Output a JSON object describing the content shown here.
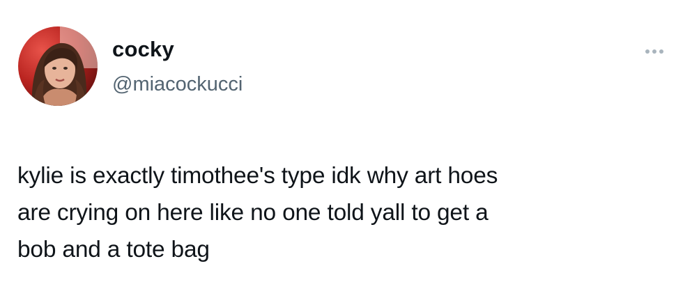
{
  "tweet": {
    "author": {
      "display_name": "cocky",
      "handle": "@miacockucci",
      "avatar_icon": "profile-photo"
    },
    "more_icon": "ellipsis-icon",
    "text_lines": [
      "kylie is exactly timothee's type idk why art hoes",
      "are crying on here like no one told yall to get a",
      "bob and a tote bag"
    ]
  },
  "colors": {
    "background": "#ffffff",
    "text": "#0f1419",
    "secondary_text": "#536471",
    "icon_muted": "#a9b4bd"
  }
}
